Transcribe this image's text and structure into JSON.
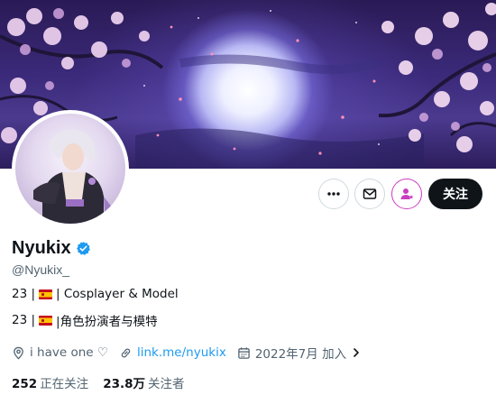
{
  "profile": {
    "name": "Nyukix",
    "handle": "@Nyukix_",
    "bio_line1_prefix": "23 |",
    "bio_line1_suffix": "| Cosplayer & Model",
    "bio_line2_prefix": "23 |",
    "bio_line2_suffix": "|角色扮演者与模特",
    "location": "i have one ♡",
    "link": "link.me/nyukix",
    "joined": "2022年7月 加入",
    "following_count": "252",
    "following_label": "正在关注",
    "followers_count": "23.8万",
    "followers_label": "关注者"
  },
  "actions": {
    "follow_label": "关注"
  },
  "icons": {
    "more": "more-icon",
    "message": "envelope-icon",
    "notify": "person-star-icon",
    "verified": "verified-badge-icon",
    "location": "location-pin-icon",
    "link": "link-icon",
    "calendar": "calendar-icon",
    "chevron": "chevron-right-icon",
    "flag": "spain-flag-icon"
  },
  "colors": {
    "follow_button": "#0f1419",
    "verified": "#1d9bf0",
    "link": "#1d9bf0",
    "notify_accent": "#c93ec0",
    "secondary_text": "#536471"
  }
}
